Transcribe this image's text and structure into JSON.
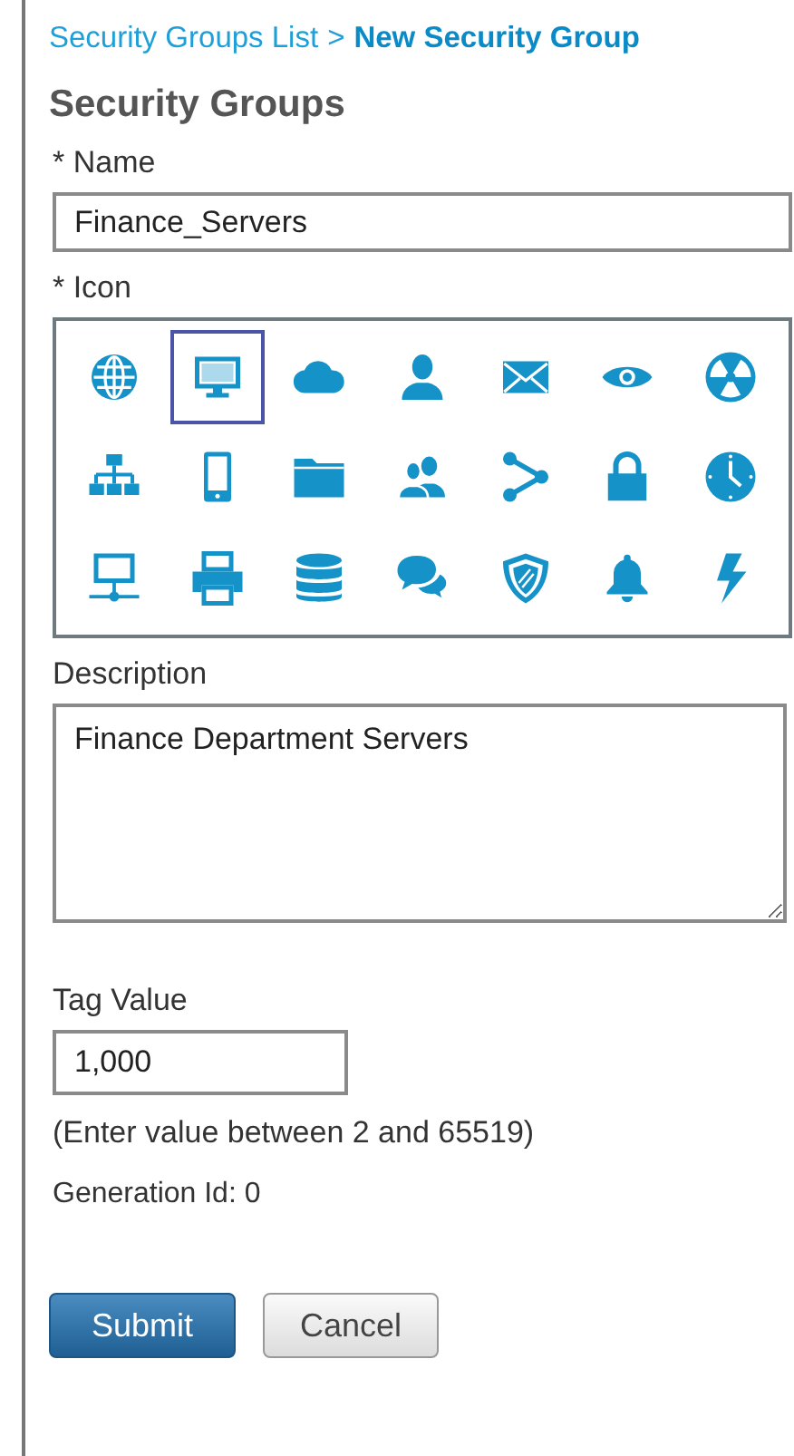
{
  "breadcrumb": {
    "parent": "Security Groups List",
    "separator": ">",
    "current": "New Security Group"
  },
  "title": "Security Groups",
  "name_field": {
    "label": "* Name",
    "value": "Finance_Servers"
  },
  "icon_picker": {
    "label": "* Icon",
    "icons": [
      {
        "kind": "globe",
        "selected": false
      },
      {
        "kind": "monitor",
        "selected": true
      },
      {
        "kind": "cloud",
        "selected": false
      },
      {
        "kind": "person",
        "selected": false
      },
      {
        "kind": "envelope",
        "selected": false
      },
      {
        "kind": "eye",
        "selected": false
      },
      {
        "kind": "radiation",
        "selected": false
      },
      {
        "kind": "sitemap",
        "selected": false
      },
      {
        "kind": "phone",
        "selected": false
      },
      {
        "kind": "folder",
        "selected": false
      },
      {
        "kind": "people",
        "selected": false
      },
      {
        "kind": "share",
        "selected": false
      },
      {
        "kind": "lock",
        "selected": false
      },
      {
        "kind": "clock",
        "selected": false
      },
      {
        "kind": "network",
        "selected": false
      },
      {
        "kind": "printer",
        "selected": false
      },
      {
        "kind": "database",
        "selected": false
      },
      {
        "kind": "chat",
        "selected": false
      },
      {
        "kind": "shield",
        "selected": false
      },
      {
        "kind": "bell",
        "selected": false
      },
      {
        "kind": "bolt",
        "selected": false
      }
    ]
  },
  "description_field": {
    "label": "Description",
    "value": "Finance Department Servers"
  },
  "tag_field": {
    "label": "Tag Value",
    "value": "1,000",
    "hint": "(Enter value between 2 and 65519)"
  },
  "generation_id": "Generation Id: 0",
  "buttons": [
    {
      "kind": "primary",
      "label": "Submit"
    },
    {
      "kind": "secondary",
      "label": "Cancel"
    }
  ]
}
